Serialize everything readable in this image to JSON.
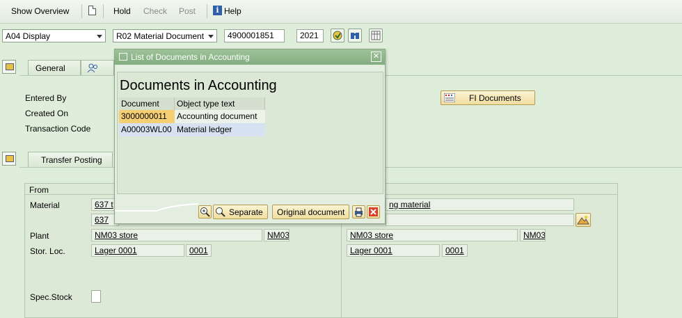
{
  "toolbar": {
    "show_overview": "Show Overview",
    "hold": "Hold",
    "check": "Check",
    "post": "Post",
    "help": "Help"
  },
  "header": {
    "action": "A04 Display",
    "reference": "R02 Material Document",
    "doc_number": "4900001851",
    "year": "2021"
  },
  "tabs1": {
    "general": "General"
  },
  "general": {
    "entered_by": "Entered By",
    "created_on": "Created On",
    "transaction_code": "Transaction Code",
    "fi_documents": "FI Documents"
  },
  "tabs2": {
    "transfer_posting": "Transfer Posting"
  },
  "transfer": {
    "from": "From",
    "material_label": "Material",
    "material_value": "637 t",
    "material_value2": "637",
    "plant_label": "Plant",
    "plant_value": "NM03 store",
    "plant_code": "NM03",
    "storloc_label": "Stor. Loc.",
    "storloc_value": "Lager 0001",
    "storloc_code": "0001",
    "spec_stock_label": "Spec.Stock",
    "to_material_value": "ng material",
    "to_plant_value": "NM03 store",
    "to_plant_code": "NM03",
    "to_storloc_value": "Lager 0001",
    "to_storloc_code": "0001"
  },
  "popup": {
    "title": "List of Documents in Accounting",
    "heading": "Documents in Accounting",
    "columns": [
      "Document",
      "Object type text"
    ],
    "rows": [
      [
        "3000000011",
        "Accounting document"
      ],
      [
        "A00003WL00",
        "Material ledger"
      ]
    ],
    "btn_separate": "Separate",
    "btn_original": "Original document"
  },
  "colors": {
    "accent": "#84ac80",
    "selected_row": "#f6cf74",
    "second_row": "#d6e2f2"
  }
}
